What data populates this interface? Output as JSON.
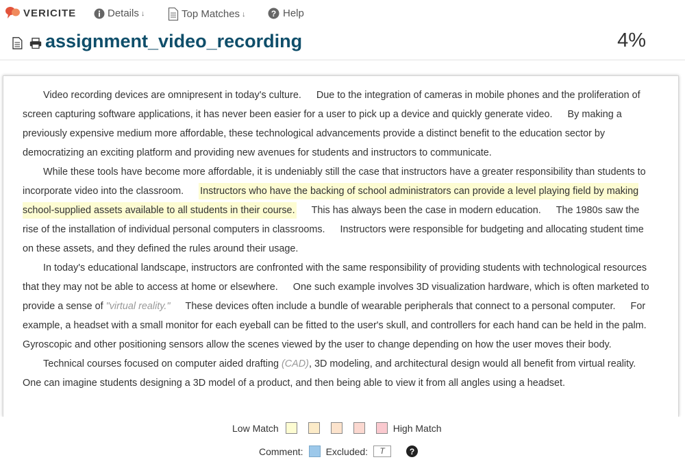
{
  "header": {
    "brand": "VERICITE",
    "nav": [
      {
        "label": "Details",
        "icon": "info-icon"
      },
      {
        "label": "Top Matches",
        "icon": "document-icon"
      },
      {
        "label": "Help",
        "icon": "help-icon"
      }
    ]
  },
  "title": "assignment_video_recording",
  "score": "4%",
  "document": {
    "p1": [
      "Video recording devices are omnipresent in today's culture.",
      "Due to the integration of cameras in mobile phones and the proliferation of screen capturing software applications, it has never been easier for a user to pick up a device and quickly generate video.",
      "By making a previously expensive medium more affordable, these technological advancements provide a distinct benefit to the education sector by democratizing an exciting platform and providing new avenues for students and instructors to communicate."
    ],
    "p2": {
      "s1": "While these tools have become more affordable, it is undeniably still the case that instructors have a greater responsibility than students to incorporate video into the classroom.",
      "highlight": "Instructors who have the backing of school administrators can provide a level playing field by making school-supplied assets available to all students in their course.",
      "s3": "This has always been the case in modern education.",
      "s4": "The 1980s saw the rise of the installation of individual personal computers in classrooms.",
      "s5": "Instructors were responsible for budgeting and allocating student time on these assets, and they defined the rules around their usage."
    },
    "p3": {
      "s1": "In today's educational landscape, instructors are confronted with the same responsibility of providing students with technological resources that they may not be able to access at home or elsewhere.",
      "s2a": "One such example involves 3D visualization hardware, which is often marketed to provide a sense of ",
      "quote": "\"virtual reality.\"",
      "s3": "These devices often include a bundle of wearable peripherals that connect to a personal computer.",
      "s4": "For example, a headset with a small monitor for each eyeball can be fitted to the user's skull, and controllers for each hand can be held in the palm. Gyroscopic and other positioning sensors allow the scenes viewed by the user to change depending on how the user moves their body."
    },
    "p4": {
      "s1a": "Technical courses focused on computer aided drafting ",
      "cad": "(CAD)",
      "s1b": ", 3D modeling, and architectural design would all benefit from virtual reality. One can imagine students designing a 3D model of a product, and then being able to view it from all angles using a headset."
    }
  },
  "legend": {
    "low_label": "Low Match",
    "high_label": "High Match",
    "swatches": [
      "#fdfcd2",
      "#fcebc8",
      "#fce3cc",
      "#fbd8d0",
      "#fac9cf"
    ],
    "comment_label": "Comment:",
    "comment_color": "#9cc8ea",
    "excluded_label": "Excluded:",
    "excluded_glyph": "T"
  }
}
